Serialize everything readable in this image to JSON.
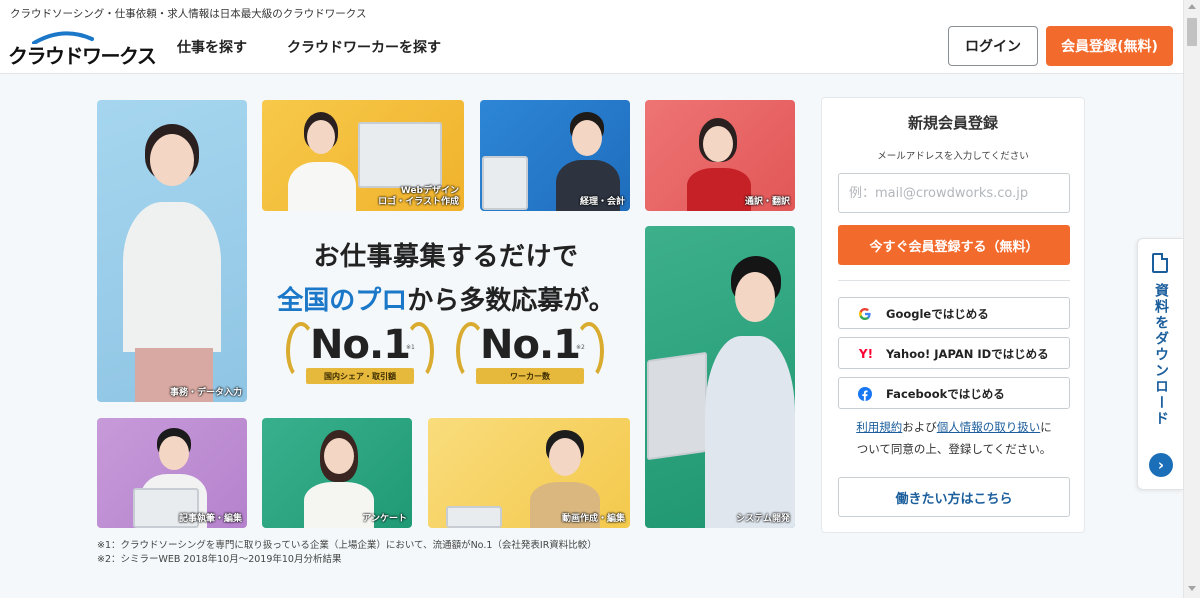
{
  "header": {
    "tagline": "クラウドソーシング・仕事依頼・求人情報は日本最大級のクラウドワークス",
    "logo_text": "クラウドワークス",
    "nav": [
      "仕事を探す",
      "クラウドワーカーを探す"
    ],
    "login_label": "ログイン",
    "register_label": "会員登録(無料)"
  },
  "tiles": {
    "office": "事務・データ入力",
    "web_design": "Webデザイン\nロゴ・イラスト作成",
    "accounting": "経理・会計",
    "translation": "通訳・翻訳",
    "system": "システム開発",
    "writing": "記事執筆・編集",
    "survey": "アンケート",
    "video": "動画作成・編集"
  },
  "hero": {
    "line1": "お仕事募集するだけで",
    "line2_accent": "全国のプロ",
    "line2_rest": "から多数応募が。",
    "award1_no": "No.1",
    "award1_mark": "※1",
    "award1_label": "国内シェア・取引額",
    "award2_no": "No.1",
    "award2_mark": "※2",
    "award2_label": "ワーカー数"
  },
  "footnotes": [
    "※1：クラウドソーシングを専門に取り扱っている企業（上場企業）において、流通額がNo.1（会社発表IR資料比較）",
    "※2：シミラーWEB 2018年10月〜2019年10月分析結果"
  ],
  "signup": {
    "title": "新規会員登録",
    "subtitle": "メールアドレスを入力してください",
    "email_placeholder": "例：mail@crowdworks.co.jp",
    "email_value": "",
    "submit_label": "今すぐ会員登録する（無料）",
    "google_label": "Googleではじめる",
    "yahoo_label": "Yahoo! JAPAN IDではじめる",
    "facebook_label": "Facebookではじめる",
    "terms_link": "利用規約",
    "terms_and": "および",
    "privacy_link": "個人情報の取り扱い",
    "terms_tail": "に",
    "terms_line2": "ついて同意の上、登録してください。",
    "worker_label": "働きたい方はこちら"
  },
  "side_tab": {
    "label": "資料をダウンロード"
  },
  "colors": {
    "accent": "#f26a2c",
    "brand_blue": "#1b77c8",
    "link": "#1b5e9c"
  }
}
